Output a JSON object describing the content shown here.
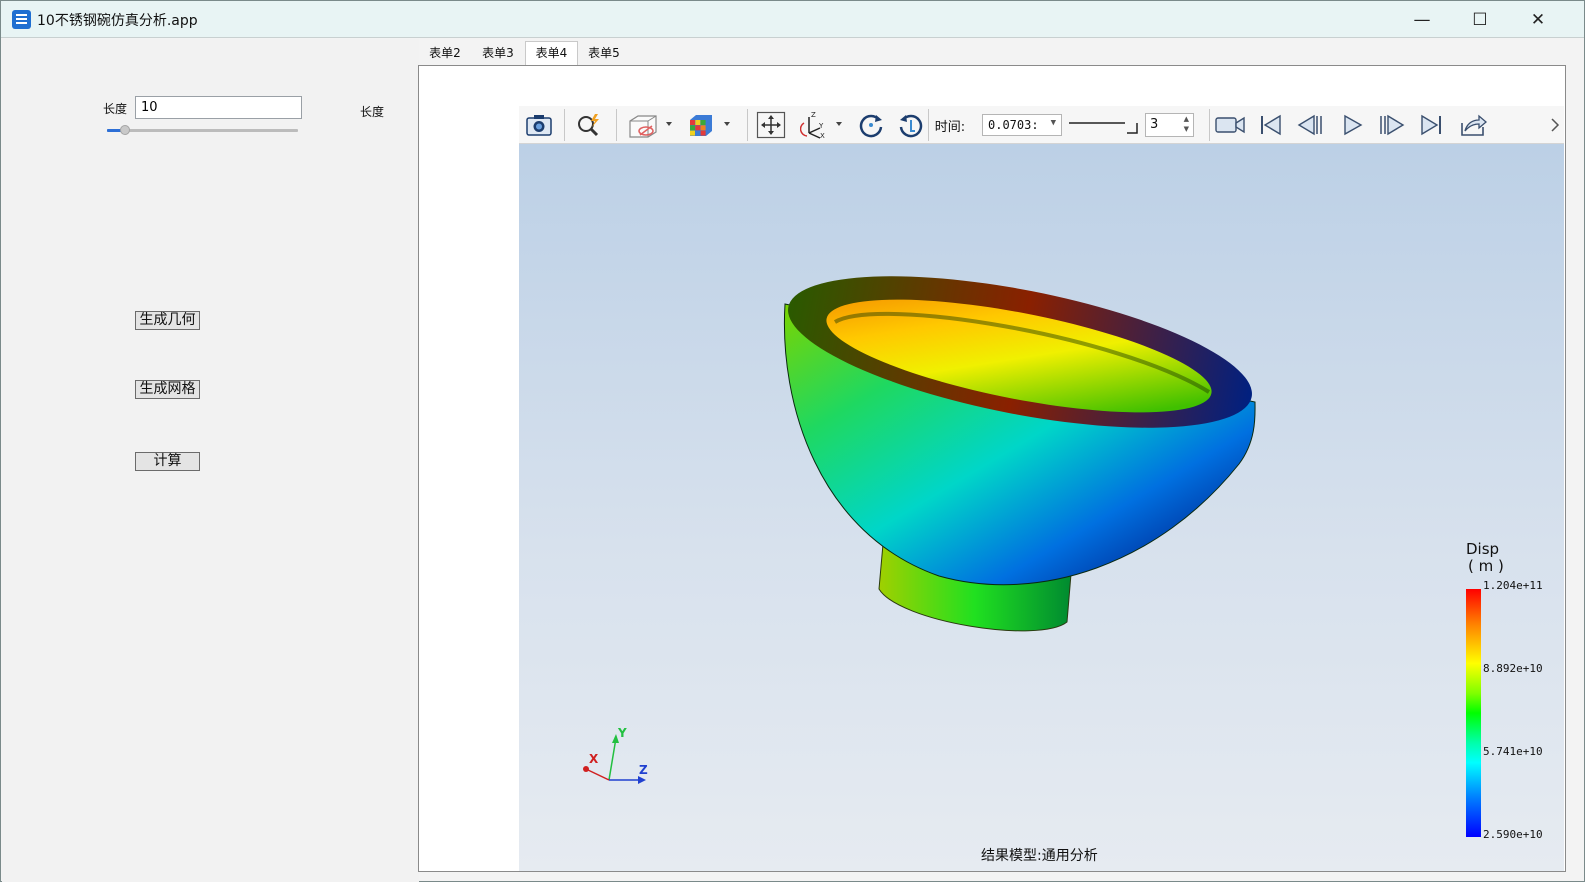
{
  "window": {
    "title": "10不锈钢碗仿真分析.app",
    "minimize_glyph": "—",
    "maximize_glyph": "☐",
    "close_glyph": "✕"
  },
  "left_panel": {
    "length_label": "长度",
    "length_value": "10",
    "length_label_right": "长度",
    "slider_value": 10,
    "buttons": {
      "generate_geometry": "生成几何",
      "generate_mesh": "生成网格",
      "compute": "计算"
    }
  },
  "tabs": [
    {
      "label": "表单2",
      "active": false
    },
    {
      "label": "表单3",
      "active": false
    },
    {
      "label": "表单4",
      "active": true
    },
    {
      "label": "表单5",
      "active": false
    }
  ],
  "toolbar": {
    "icons": [
      "camera-icon",
      "zoom-icon",
      "box-view-icon",
      "cube-color-icon",
      "pan-icon",
      "axes-icon",
      "rotate-icon",
      "rotate-reverse-icon",
      "record-icon",
      "first-frame-icon",
      "prev-frame-icon",
      "play-icon",
      "next-frame-icon",
      "last-frame-icon",
      "export-icon"
    ],
    "time_label": "时间:",
    "time_value": "0.0703:",
    "step_value": "3"
  },
  "viewport": {
    "triad": {
      "x": "X",
      "y": "Y",
      "z": "Z"
    },
    "legend": {
      "title": "Disp",
      "unit": "( m )",
      "ticks": [
        "1.204e+11",
        "8.892e+10",
        "5.741e+10",
        "2.590e+10"
      ]
    },
    "status": "结果模型:通用分析"
  },
  "colors": {
    "accent": "#2d6fd6",
    "titlebar": "#e8f4f4"
  }
}
